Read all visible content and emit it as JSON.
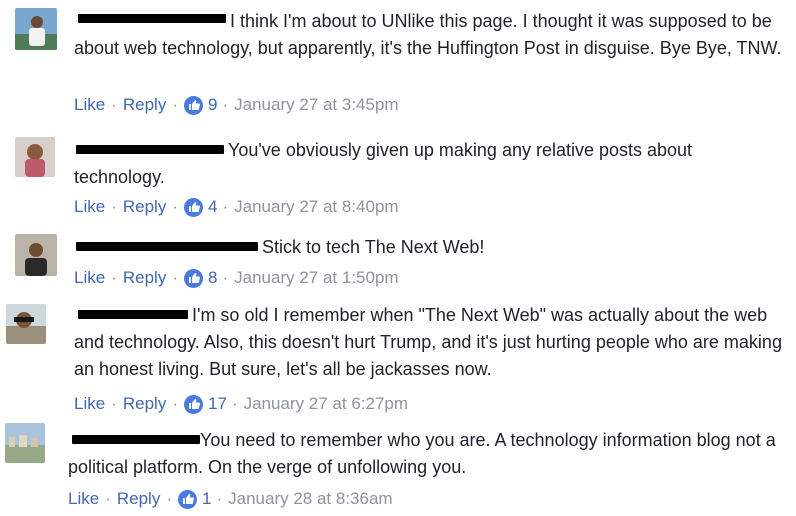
{
  "comments": [
    {
      "text": "I think I'm about to UNlike this page. I thought it was supposed to be about web technology, but apparently, it's the Huffington Post in disguise. Bye Bye, TNW.",
      "like_label": "Like",
      "reply_label": "Reply",
      "reactions": "9",
      "timestamp": "January 27 at 3:45pm"
    },
    {
      "text": "You've obviously given up making any relative posts about technology.",
      "like_label": "Like",
      "reply_label": "Reply",
      "reactions": "4",
      "timestamp": "January 27 at 8:40pm"
    },
    {
      "text": "Stick to tech The Next Web!",
      "like_label": "Like",
      "reply_label": "Reply",
      "reactions": "8",
      "timestamp": "January 27 at 1:50pm"
    },
    {
      "text": "I'm so old I remember when \"The Next Web\" was actually about the web and technology. Also, this doesn't hurt Trump, and it's just hurting people who are making an honest living. But sure, let's all be jackasses now.",
      "like_label": "Like",
      "reply_label": "Reply",
      "reactions": "17",
      "timestamp": "January 27 at 6:27pm"
    },
    {
      "text": "You need to remember who you are. A technology information blog not a political platform. On the verge of unfollowing you.",
      "like_label": "Like",
      "reply_label": "Reply",
      "reactions": "1",
      "timestamp": "January 28 at 8:36am"
    }
  ],
  "separator": "·",
  "colors": {
    "link": "#4267b2",
    "meta": "#8d949e",
    "badge": "#4a7ae0"
  }
}
